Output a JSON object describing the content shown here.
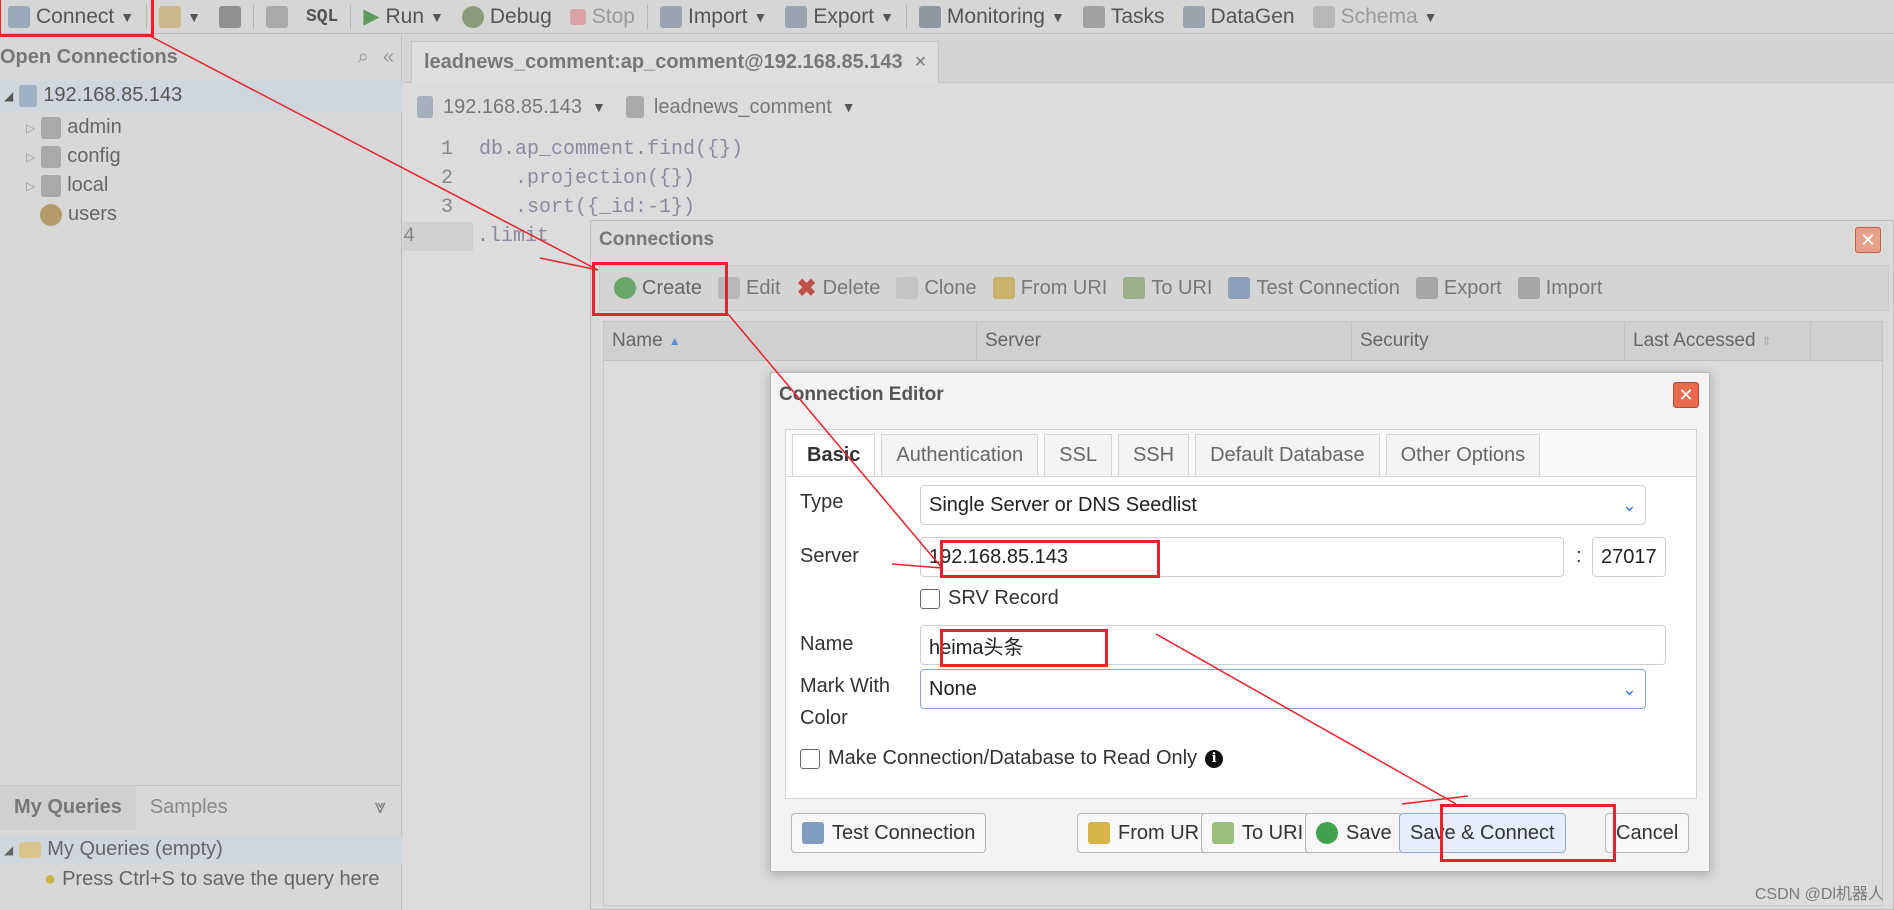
{
  "toolbar": {
    "connect": "Connect",
    "sql": "SQL",
    "run": "Run",
    "debug": "Debug",
    "stop": "Stop",
    "import": "Import",
    "export": "Export",
    "monitoring": "Monitoring",
    "tasks": "Tasks",
    "datagen": "DataGen",
    "schema": "Schema"
  },
  "left_panel": {
    "title": "Open Connections",
    "tree": {
      "root": "192.168.85.143",
      "children": [
        "admin",
        "config",
        "local",
        "users"
      ]
    },
    "tabs": {
      "my_queries": "My Queries",
      "samples": "Samples"
    },
    "queries_folder": "My Queries (empty)",
    "hint": "Press Ctrl+S to save the query here"
  },
  "editor": {
    "tab": "leadnews_comment:ap_comment@192.168.85.143",
    "server": "192.168.85.143",
    "database": "leadnews_comment",
    "lines": [
      {
        "n": "1",
        "code": "db.ap_comment.find({})"
      },
      {
        "n": "2",
        "code": "   .projection({})"
      },
      {
        "n": "3",
        "code": "   .sort({_id:-1})"
      },
      {
        "n": "4",
        "code": "   .limit"
      }
    ]
  },
  "connections": {
    "title": "Connections",
    "toolbar": {
      "create": "Create",
      "edit": "Edit",
      "delete": "Delete",
      "clone": "Clone",
      "from_uri": "From URI",
      "to_uri": "To URI",
      "test": "Test Connection",
      "export": "Export",
      "import": "Import"
    },
    "columns": {
      "name": "Name",
      "server": "Server",
      "security": "Security",
      "last_accessed": "Last Accessed"
    }
  },
  "editor_dialog": {
    "title": "Connection Editor",
    "tabs": [
      "Basic",
      "Authentication",
      "SSL",
      "SSH",
      "Default Database",
      "Other Options"
    ],
    "type_label": "Type",
    "type_value": "Single Server or DNS Seedlist",
    "server_label": "Server",
    "server_value": "192.168.85.143",
    "port_sep": ":",
    "port_value": "27017",
    "srv_label": "SRV Record",
    "name_label": "Name",
    "name_value": "heima头条",
    "color_label_1": "Mark With",
    "color_label_2": "Color",
    "color_value": "None",
    "readonly_label": "Make Connection/Database to Read Only",
    "info_glyph": "i",
    "buttons": {
      "test": "Test Connection",
      "from_uri": "From URI",
      "to_uri": "To URI",
      "save": "Save",
      "save_connect": "Save & Connect",
      "cancel": "Cancel"
    }
  },
  "watermark": "CSDN @Dl机器人",
  "colors": {
    "highlight": "#e8222a",
    "accent": "#3b7bd8"
  }
}
